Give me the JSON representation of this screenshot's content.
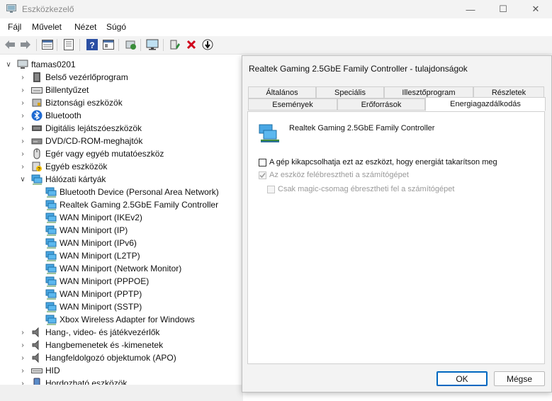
{
  "window": {
    "title": "Eszközkezelő",
    "minimize_glyph": "—",
    "maximize_glyph": "☐",
    "close_glyph": "✕"
  },
  "menu": [
    "Fájl",
    "Művelet",
    "Nézet",
    "Súgó"
  ],
  "toolbar_icons": [
    "back-arrow-icon",
    "forward-arrow-icon",
    "properties-grid-icon",
    "document-icon",
    "help-icon",
    "view-icon",
    "scan-hardware-icon",
    "monitor-icon",
    "enable-device-icon",
    "uninstall-x-icon",
    "update-driver-icon"
  ],
  "tree": {
    "root": "ftamas0201",
    "categories": [
      {
        "label": "Belső vezérlőprogram",
        "icon": "firmware-icon"
      },
      {
        "label": "Billentyűzet",
        "icon": "keyboard-icon"
      },
      {
        "label": "Biztonsági eszközök",
        "icon": "security-device-icon"
      },
      {
        "label": "Bluetooth",
        "icon": "bluetooth-icon"
      },
      {
        "label": "Digitális lejátszóeszközök",
        "icon": "media-player-icon"
      },
      {
        "label": "DVD/CD-ROM-meghajtók",
        "icon": "dvd-drive-icon"
      },
      {
        "label": "Egér vagy egyéb mutatóeszköz",
        "icon": "mouse-icon"
      },
      {
        "label": "Egyéb eszközök",
        "icon": "unknown-device-icon"
      },
      {
        "label": "Hálózati kártyák",
        "icon": "network-adapter-icon",
        "expanded": true,
        "children": [
          "Bluetooth Device (Personal Area Network)",
          "Realtek Gaming 2.5GbE Family Controller",
          "WAN Miniport (IKEv2)",
          "WAN Miniport (IP)",
          "WAN Miniport (IPv6)",
          "WAN Miniport (L2TP)",
          "WAN Miniport (Network Monitor)",
          "WAN Miniport (PPPOE)",
          "WAN Miniport (PPTP)",
          "WAN Miniport (SSTP)",
          "Xbox Wireless Adapter for Windows"
        ]
      },
      {
        "label": "Hang-, video- és játékvezérlők",
        "icon": "speaker-icon"
      },
      {
        "label": "Hangbemenetek és -kimenetek",
        "icon": "speaker-icon"
      },
      {
        "label": "Hangfeldolgozó objektumok (APO)",
        "icon": "speaker-icon"
      },
      {
        "label": "HID",
        "icon": "hid-icon"
      },
      {
        "label": "Hordozható eszközök",
        "icon": "portable-device-icon"
      }
    ]
  },
  "dialog": {
    "title": "Realtek Gaming 2.5GbE Family Controller - tulajdonságok",
    "tabs_row1": [
      "Általános",
      "Speciális",
      "Illesztőprogram",
      "Részletek"
    ],
    "tabs_row2": [
      "Események",
      "Erőforrások",
      "Energiagazdálkodás"
    ],
    "active_tab": "Energiagazdálkodás",
    "device_name": "Realtek Gaming 2.5GbE Family Controller",
    "options": [
      {
        "label": "A gép kikapcsolhatja ezt az eszközt, hogy energiát takarítson meg",
        "checked": false,
        "enabled": true
      },
      {
        "label": "Az eszköz felébresztheti a számítógépet",
        "checked": true,
        "enabled": false
      },
      {
        "label": "Csak magic-csomag ébresztheti fel a számítógépet",
        "checked": false,
        "enabled": false
      }
    ],
    "ok_label": "OK",
    "cancel_label": "Mégse"
  },
  "colors": {
    "accent": "#0067c0",
    "titlebar": "#f3f3f3",
    "disabled_text": "#9a9a9a"
  }
}
